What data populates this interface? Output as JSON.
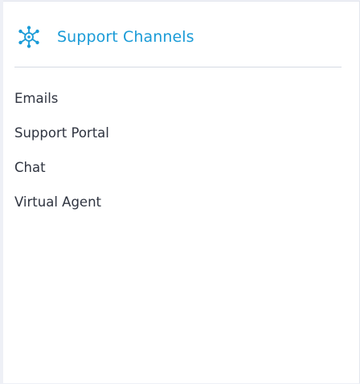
{
  "header": {
    "title": "Support Channels",
    "icon": "network-hub-icon",
    "accent_color": "#1a9bd7"
  },
  "channels": [
    {
      "label": "Emails"
    },
    {
      "label": "Support Portal"
    },
    {
      "label": "Chat"
    },
    {
      "label": "Virtual Agent"
    }
  ]
}
